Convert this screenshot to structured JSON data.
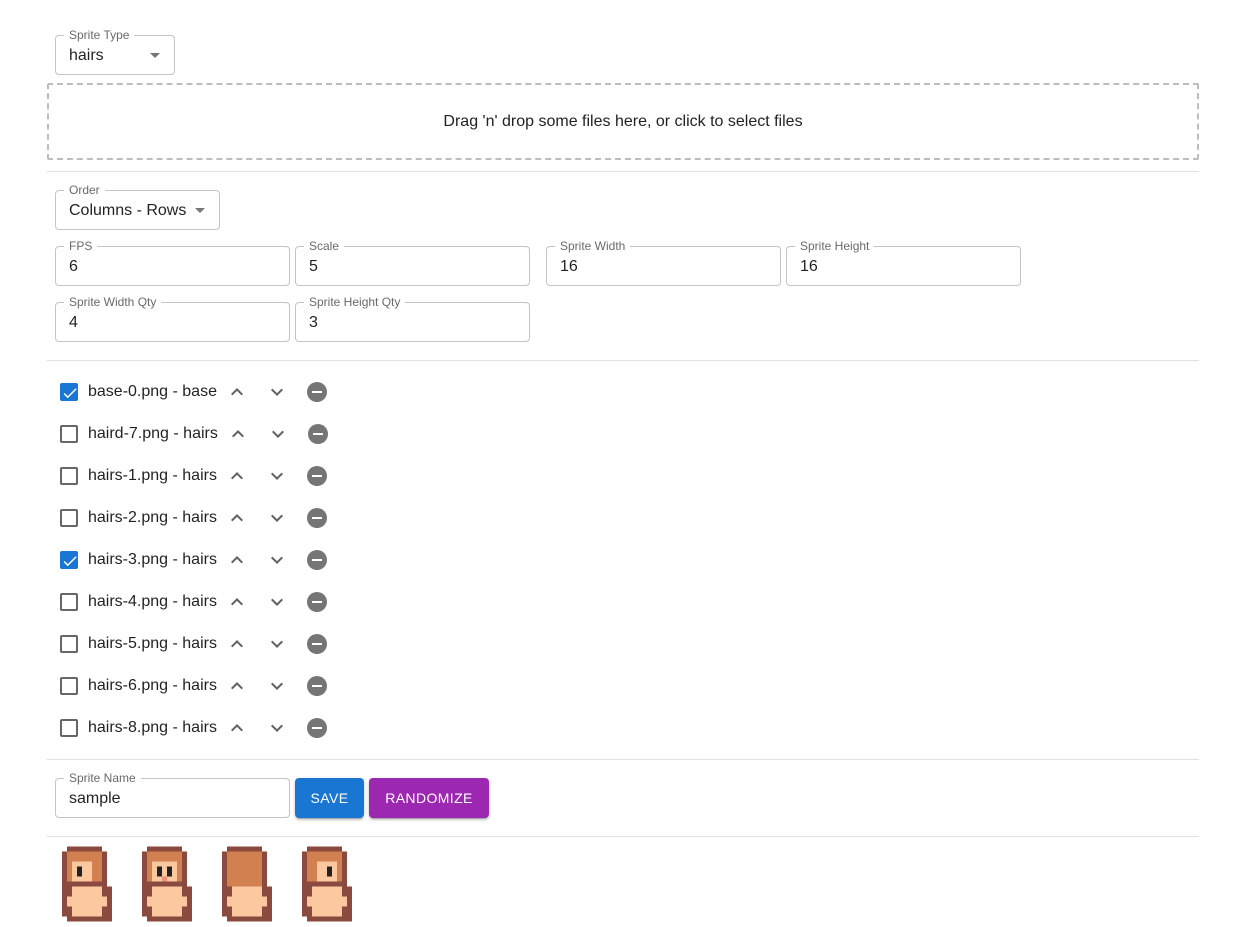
{
  "sprite_type": {
    "label": "Sprite Type",
    "value": "hairs"
  },
  "dropzone": {
    "text": "Drag 'n' drop some files here, or click to select files"
  },
  "order": {
    "label": "Order",
    "value": "Columns - Rows"
  },
  "fields": {
    "fps": {
      "label": "FPS",
      "value": "6"
    },
    "scale": {
      "label": "Scale",
      "value": "5"
    },
    "sprite_width": {
      "label": "Sprite Width",
      "value": "16"
    },
    "sprite_height": {
      "label": "Sprite Height",
      "value": "16"
    },
    "sprite_width_qty": {
      "label": "Sprite Width Qty",
      "value": "4"
    },
    "sprite_height_qty": {
      "label": "Sprite Height Qty",
      "value": "3"
    }
  },
  "files": [
    {
      "label": "base-0.png - base",
      "checked": true
    },
    {
      "label": "haird-7.png - hairs",
      "checked": false
    },
    {
      "label": "hairs-1.png - hairs",
      "checked": false
    },
    {
      "label": "hairs-2.png - hairs",
      "checked": false
    },
    {
      "label": "hairs-3.png - hairs",
      "checked": true
    },
    {
      "label": "hairs-4.png - hairs",
      "checked": false
    },
    {
      "label": "hairs-5.png - hairs",
      "checked": false
    },
    {
      "label": "hairs-6.png - hairs",
      "checked": false
    },
    {
      "label": "hairs-8.png - hairs",
      "checked": false
    }
  ],
  "sprite_name": {
    "label": "Sprite Name",
    "value": "sample"
  },
  "buttons": {
    "save": "SAVE",
    "randomize": "RANDOMIZE"
  },
  "icons": {
    "move_up": "chevron-up-icon",
    "move_down": "chevron-down-icon",
    "remove": "remove-circle-icon",
    "dropdown": "caret-down-icon",
    "check": "check-icon"
  },
  "preview_sprites": [
    {
      "view": "side-left"
    },
    {
      "view": "front"
    },
    {
      "view": "back"
    },
    {
      "view": "side-right"
    }
  ],
  "colors": {
    "primary": "#1976d2",
    "secondary": "#9c27b0",
    "icon_gray": "#757575",
    "hair": "#d2804f",
    "outline": "#8a4a3f",
    "skin": "#fbc8a0"
  }
}
